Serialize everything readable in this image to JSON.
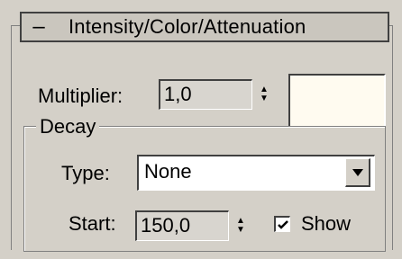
{
  "rollout": {
    "toggle": "–",
    "title": "Intensity/Color/Attenuation"
  },
  "multiplier": {
    "label": "Multiplier:",
    "value": "1,0",
    "color": "#fffbf0"
  },
  "decay": {
    "group_title": "Decay",
    "type_label": "Type:",
    "type_value": "None",
    "start_label": "Start:",
    "start_value": "150,0",
    "show_label": "Show",
    "show_checked": true
  },
  "icons": {
    "spinner": "spinner-up-down-icon",
    "dropdown": "triangle-down-icon",
    "check": "checkmark-icon"
  }
}
